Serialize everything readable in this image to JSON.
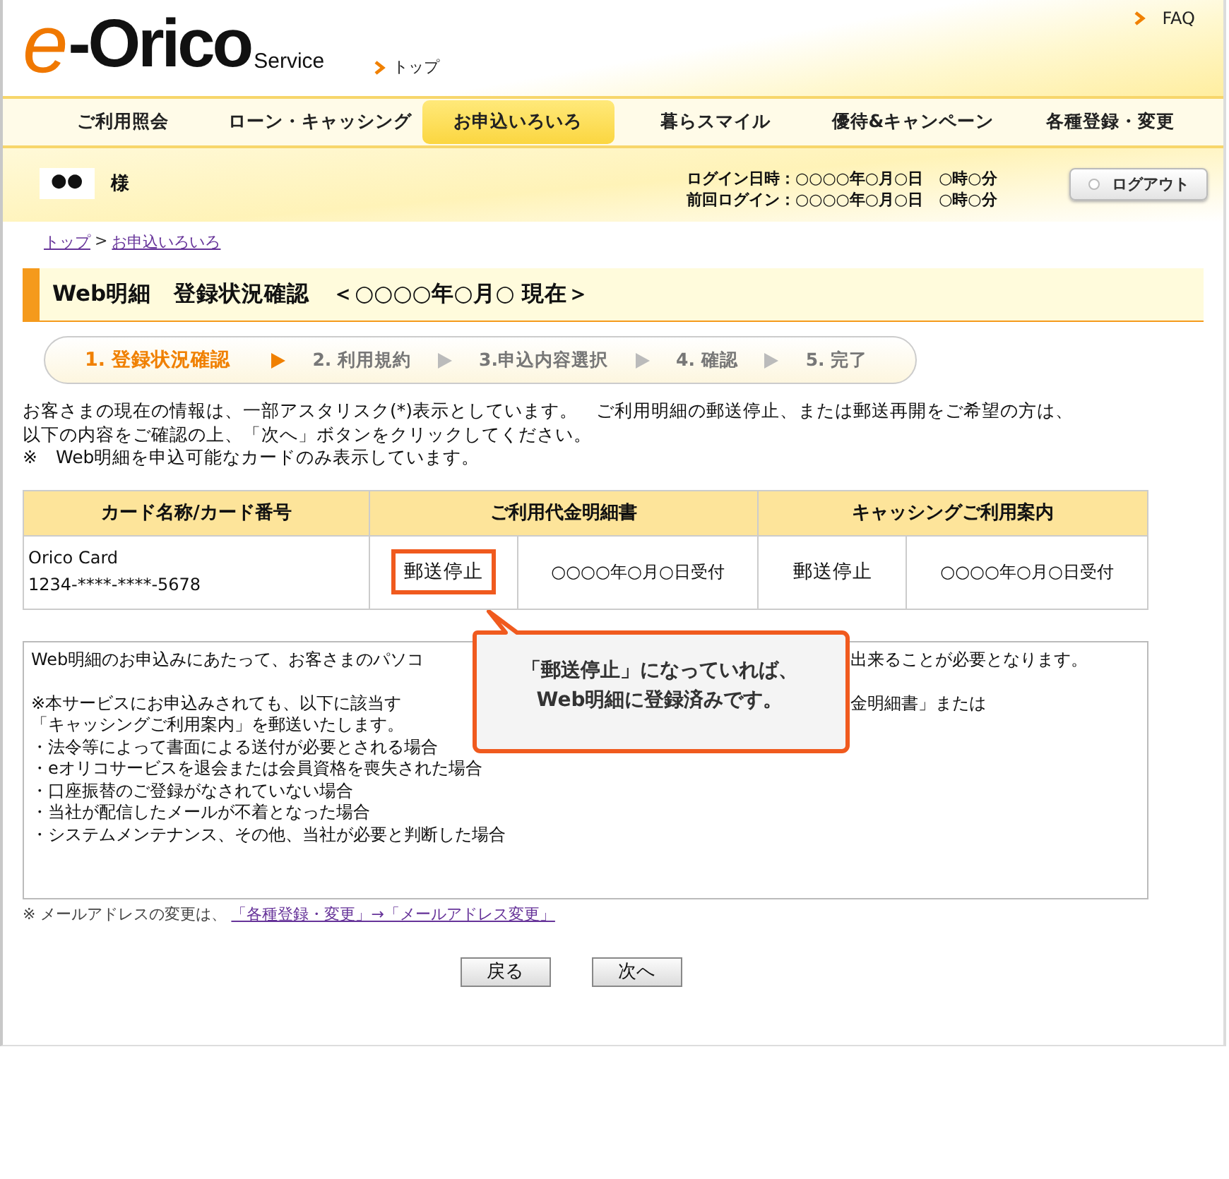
{
  "header": {
    "logo": {
      "mark": "e",
      "name": "-Orico",
      "sub": "Service"
    },
    "top_link": "トップ",
    "faq": "FAQ"
  },
  "nav": [
    {
      "label": "ご利用照会",
      "selected": false
    },
    {
      "label": "ローン・キャッシング",
      "selected": false
    },
    {
      "label": "お申込いろいろ",
      "selected": true
    },
    {
      "label": "暮らスマイル",
      "selected": false
    },
    {
      "label": "優待&キャンペーン",
      "selected": false
    },
    {
      "label": "各種登録・変更",
      "selected": false
    }
  ],
  "user": {
    "name": "●●",
    "honorific": "様",
    "login_time": "ログイン日時：○○○○年○月○日　○時○分",
    "last_login": "前回ログイン：○○○○年○月○日　○時○分",
    "logout": "ログアウト"
  },
  "breadcrumb": {
    "items": [
      "トップ",
      "お申込いろいろ"
    ],
    "separator": ">"
  },
  "title": "Web明細　登録状況確認　＜○○○○年○月○ 現在＞",
  "steps": [
    {
      "label": "1. 登録状況確認",
      "selected": true
    },
    {
      "label": "2. 利用規約",
      "selected": false
    },
    {
      "label": "3.申込内容選択",
      "selected": false
    },
    {
      "label": "4. 確認",
      "selected": false
    },
    {
      "label": "5. 完了",
      "selected": false
    }
  ],
  "intro": [
    "お客さまの現在の情報は、一部アスタリスク(*)表示としています。　ご利用明細の郵送停止、または郵送再開をご希望の方は、",
    "以下の内容をご確認の上、「次へ」ボタンをクリックしてください。",
    "※　Web明細を申込可能なカードのみ表示しています。"
  ],
  "table": {
    "columns": [
      "カード名称/カード番号",
      "ご利用代金明細書",
      "キャッシングご利用案内"
    ],
    "rows": [
      {
        "card_name": "Orico Card",
        "card_number": "1234-****-****-5678",
        "statement": {
          "status": "郵送停止",
          "date": "○○○○年○月○日受付",
          "highlighted": true
        },
        "cashing": {
          "status": "郵送停止",
          "date": "○○○○年○月○日受付",
          "highlighted": false
        }
      }
    ]
  },
  "callout": [
    "「郵送停止」になっていれば、",
    "Web明細に登録済みです。"
  ],
  "notice": [
    {
      "left": "Web明細のお申込みにあたって、お客さまのパソコ",
      "right": "出来ることが必要となります。"
    },
    {
      "left": "※本サービスにお申込みされても、以下に該当す",
      "right": "金明細書」または"
    },
    {
      "text": "「キャッシングご利用案内」を郵送いたします。"
    },
    {
      "text": "・法令等によって書面による送付が必要とされる場合"
    },
    {
      "text": "・eオリコサービスを退会または会員資格を喪失された場合"
    },
    {
      "text": "・口座振替のご登録がなされていない場合"
    },
    {
      "text": "・当社が配信したメールが不着となった場合"
    },
    {
      "text": "・システムメンテナンス、その他、当社が必要と判断した場合"
    }
  ],
  "note": {
    "text": "※ メールアドレスの変更は、",
    "link": "「各種登録・変更」→「メールアドレス変更」"
  },
  "buttons": [
    "戻る",
    "次へ"
  ]
}
